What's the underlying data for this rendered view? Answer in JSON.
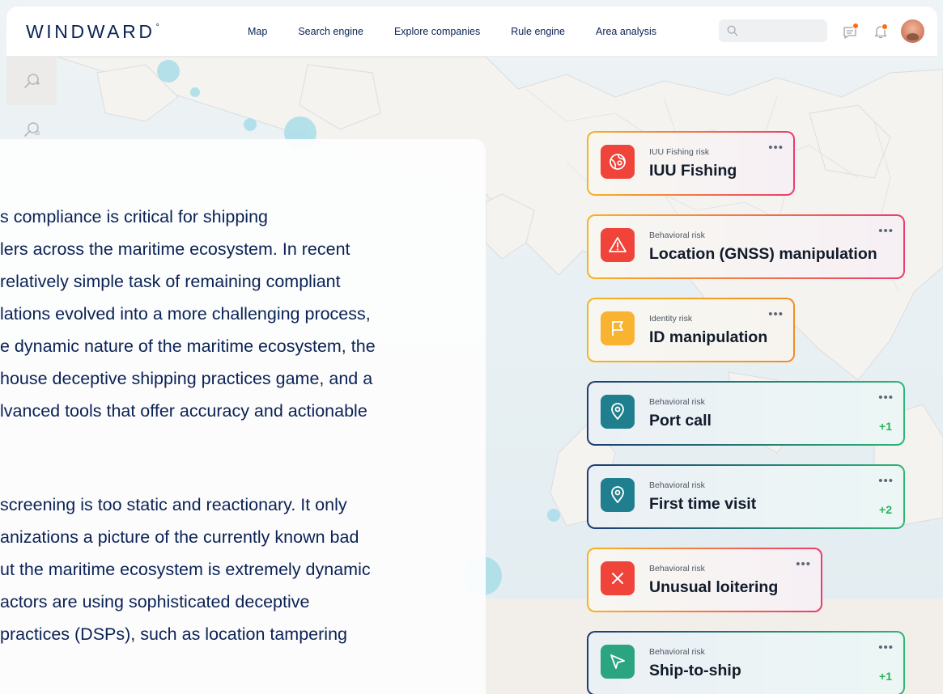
{
  "header": {
    "logo": "WINDWARD",
    "logo_mark": "°",
    "nav": [
      "Map",
      "Search engine",
      "Explore companies",
      "Rule engine",
      "Area analysis"
    ],
    "search_placeholder": ""
  },
  "toolstrip": {
    "icons": [
      "zoom-in-icon",
      "search-list-icon"
    ]
  },
  "text_panel": {
    "paragraph1": [
      "s compliance is critical for shipping",
      "lers across the maritime ecosystem. In recent",
      " relatively simple task of remaining compliant",
      "lations evolved into a more challenging process,",
      "e dynamic nature of the maritime ecosystem, the",
      "house deceptive shipping practices game, and a",
      "lvanced tools that offer accuracy and actionable"
    ],
    "paragraph2": [
      "screening is too static and reactionary. It only",
      "anizations a picture of the currently known bad",
      "ut the maritime ecosystem is extremely dynamic",
      "actors are using sophisticated deceptive",
      "practices (DSPs), such as location tampering"
    ]
  },
  "risk_cards": [
    {
      "category": "IUU Fishing risk",
      "title": "IUU Fishing",
      "more": "•••",
      "count": "",
      "icon": "globe-fish-icon",
      "icon_color": "#f0433a",
      "border": [
        "#f7b321",
        "#ec3b6f"
      ]
    },
    {
      "category": "Behavioral risk",
      "title": "Location (GNSS) manipulation",
      "more": "•••",
      "count": "",
      "icon": "warning-triangle-icon",
      "icon_color": "#f0433a",
      "border": [
        "#f7b321",
        "#ec3b6f"
      ]
    },
    {
      "category": "Identity risk",
      "title": "ID manipulation",
      "more": "•••",
      "count": "",
      "icon": "flag-icon",
      "icon_color": "#f8b331",
      "border": [
        "#f7b321",
        "#f28c22"
      ]
    },
    {
      "category": "Behavioral risk",
      "title": "Port call",
      "more": "•••",
      "count": "+1",
      "icon": "location-pin-icon",
      "icon_color": "#1f7f8e",
      "border": [
        "#1d3c72",
        "#2fb577"
      ]
    },
    {
      "category": "Behavioral risk",
      "title": "First time visit",
      "more": "•••",
      "count": "+2",
      "icon": "location-pin-icon",
      "icon_color": "#1f7f8e",
      "border": [
        "#1d3c72",
        "#2fb577"
      ]
    },
    {
      "category": "Behavioral risk",
      "title": "Unusual loitering",
      "more": "•••",
      "count": "",
      "icon": "close-x-icon",
      "icon_color": "#f0433a",
      "border": [
        "#f7b321",
        "#ec3b6f"
      ]
    },
    {
      "category": "Behavioral risk",
      "title": "Ship-to-ship",
      "more": "•••",
      "count": "+1",
      "icon": "send-arrow-icon",
      "icon_color": "#2aa57f",
      "border": [
        "#1d3c72",
        "#2fb577"
      ]
    }
  ]
}
